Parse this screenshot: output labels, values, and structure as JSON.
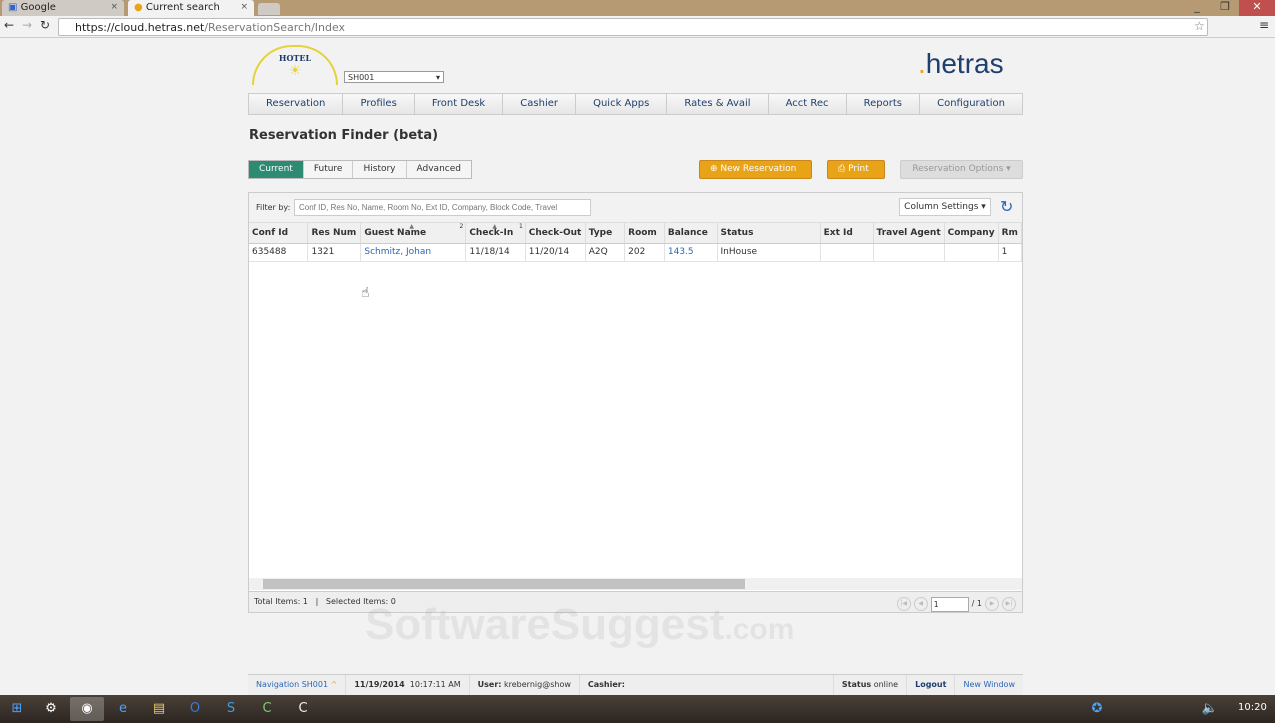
{
  "browser": {
    "tabs": [
      {
        "label": "Google"
      },
      {
        "label": "Current search"
      }
    ],
    "url_host": "https://cloud.hetras.net",
    "url_path": "/ReservationSearch/Index"
  },
  "header": {
    "logo_text": "HOTEL",
    "hotel_select": "SH001",
    "brand": "hetras",
    "brand_dot": "."
  },
  "nav": [
    "Reservation",
    "Profiles",
    "Front Desk",
    "Cashier",
    "Quick Apps",
    "Rates & Avail",
    "Acct Rec",
    "Reports",
    "Configuration"
  ],
  "page_title": "Reservation Finder (beta)",
  "views": [
    "Current",
    "Future",
    "History",
    "Advanced"
  ],
  "actions": {
    "new_reservation": "New Reservation",
    "print": "Print",
    "options": "Reservation Options"
  },
  "filter": {
    "label": "Filter by:",
    "placeholder": "Conf ID, Res No, Name, Room No, Ext ID, Company, Block Code, Travel"
  },
  "column_settings": "Column Settings",
  "table": {
    "columns": [
      "Conf Id",
      "Res Num",
      "Guest Name",
      "Check-In",
      "Check-Out",
      "Type",
      "Room",
      "Balance",
      "Status",
      "Ext Id",
      "Travel Agent",
      "Company",
      "Rm"
    ],
    "sort_indices": {
      "guest_name": "2",
      "check_in": "1"
    },
    "rows": [
      [
        "635488",
        "1321",
        "Schmitz, Johan",
        "11/18/14",
        "11/20/14",
        "A2Q",
        "202",
        "143.5",
        "InHouse",
        "",
        "",
        "",
        "1"
      ]
    ]
  },
  "grid_footer": {
    "total": "Total Items: 1",
    "sep": "|",
    "selected": "Selected Items: 0",
    "page": "1",
    "of": "/ 1"
  },
  "watermark": "SoftwareSuggest",
  "watermark_suffix": ".com",
  "statusbar": {
    "navigation": "Navigation SH001",
    "date": "11/19/2014",
    "time": "10:17:11 AM",
    "user_label": "User:",
    "user": "krebernig@show",
    "cashier": "Cashier:",
    "status_label": "Status",
    "status": "online",
    "logout": "Logout",
    "new_window": "New Window"
  },
  "taskbar": {
    "clock": "10:20"
  },
  "colors": {
    "accent": "#2e8b73",
    "orange": "#e8a317",
    "brand": "#1f3f6e",
    "link": "#2a66b8"
  }
}
